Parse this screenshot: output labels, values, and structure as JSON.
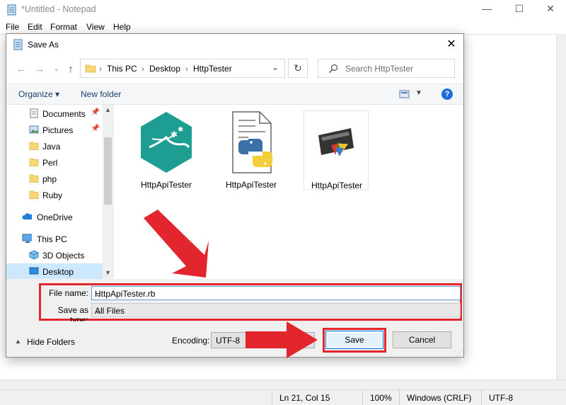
{
  "notepad": {
    "title": "*Untitled - Notepad",
    "menu": [
      "File",
      "Edit",
      "Format",
      "View",
      "Help"
    ],
    "window_controls": {
      "minimize": "—",
      "maximize": "☐",
      "close": "✕"
    },
    "status": {
      "position": "Ln 21, Col 15",
      "zoom": "100%",
      "line_ending": "Windows (CRLF)",
      "encoding": "UTF-8"
    }
  },
  "dialog": {
    "title": "Save As",
    "close_glyph": "✕",
    "address": {
      "segments": [
        "This PC",
        "Desktop",
        "HttpTester"
      ],
      "separator": "›"
    },
    "search_placeholder": "Search HttpTester",
    "toolbar": {
      "organize": "Organize ▾",
      "new_folder": "New folder",
      "help": "?"
    },
    "nav_items": [
      {
        "label": "Documents",
        "icon": "documents-icon",
        "pinned": true
      },
      {
        "label": "Pictures",
        "icon": "pictures-icon",
        "pinned": true
      },
      {
        "label": "Java",
        "icon": "folder-icon",
        "pinned": false
      },
      {
        "label": "Perl",
        "icon": "folder-icon",
        "pinned": false
      },
      {
        "label": "php",
        "icon": "folder-icon",
        "pinned": false
      },
      {
        "label": "Ruby",
        "icon": "folder-icon",
        "pinned": false
      },
      {
        "label": "OneDrive",
        "icon": "onedrive-icon",
        "pinned": false
      },
      {
        "label": "This PC",
        "icon": "this-pc-icon",
        "pinned": false
      },
      {
        "label": "3D Objects",
        "icon": "3d-objects-icon",
        "pinned": false
      },
      {
        "label": "Desktop",
        "icon": "desktop-icon",
        "pinned": false,
        "selected": true
      }
    ],
    "files": [
      {
        "name": "HttpApiTester",
        "icon": "perl-file-icon"
      },
      {
        "name": "HttpApiTester",
        "icon": "python-file-icon"
      },
      {
        "name": "HttpApiTester",
        "icon": "executable-file-icon"
      }
    ],
    "file_name_label": "File name:",
    "file_name_value": "HttpApiTester.rb",
    "save_type_label": "Save as type:",
    "save_type_value": "All Files",
    "hide_folders": "Hide Folders",
    "encoding_label": "Encoding:",
    "encoding_value": "UTF-8",
    "save_button": "Save",
    "cancel_button": "Cancel"
  },
  "colors": {
    "accent": "#0078d7",
    "highlight": "#e3262d",
    "selection": "#cce8ff"
  }
}
